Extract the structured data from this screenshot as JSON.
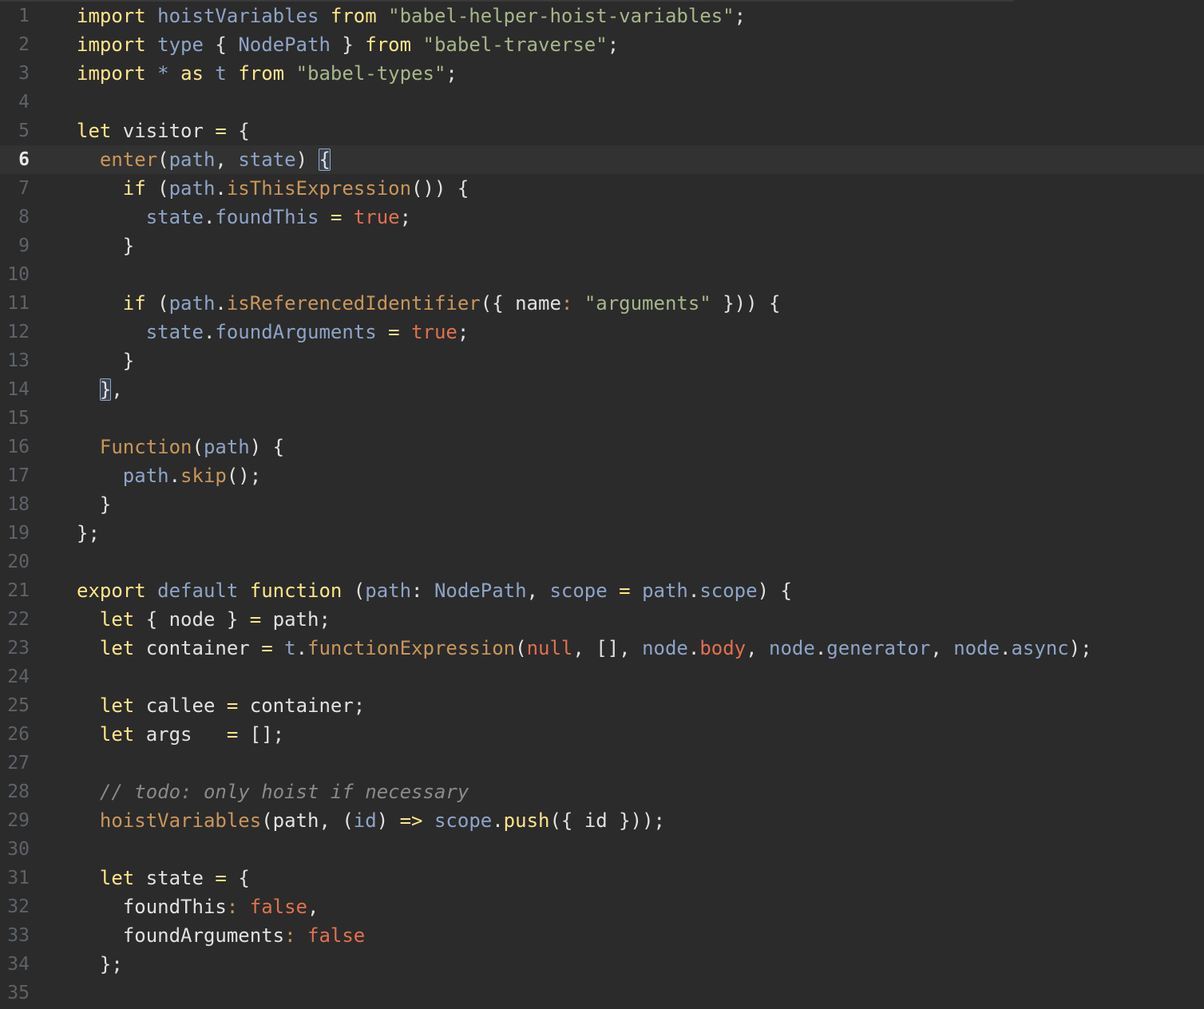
{
  "editor": {
    "current_line": 6,
    "lines": [
      {
        "num": "1",
        "tokens": [
          [
            "kw",
            "import "
          ],
          [
            "var",
            "hoistVariables "
          ],
          [
            "kw",
            "from "
          ],
          [
            "str",
            "\"babel-helper-hoist-variables\""
          ],
          [
            "plain",
            ";"
          ]
        ]
      },
      {
        "num": "2",
        "tokens": [
          [
            "kw",
            "import "
          ],
          [
            "var",
            "type "
          ],
          [
            "plain",
            "{ "
          ],
          [
            "var",
            "NodePath "
          ],
          [
            "plain",
            "} "
          ],
          [
            "kw",
            "from "
          ],
          [
            "str",
            "\"babel-traverse\""
          ],
          [
            "plain",
            ";"
          ]
        ]
      },
      {
        "num": "3",
        "tokens": [
          [
            "kw",
            "import "
          ],
          [
            "var",
            "* "
          ],
          [
            "kw",
            "as "
          ],
          [
            "var",
            "t "
          ],
          [
            "kw",
            "from "
          ],
          [
            "str",
            "\"babel-types\""
          ],
          [
            "plain",
            ";"
          ]
        ]
      },
      {
        "num": "4",
        "tokens": []
      },
      {
        "num": "5",
        "tokens": [
          [
            "kw",
            "let "
          ],
          [
            "plain",
            "visitor "
          ],
          [
            "kw",
            "= "
          ],
          [
            "plain",
            "{"
          ]
        ]
      },
      {
        "num": "6",
        "tokens": [
          [
            "plain",
            "  "
          ],
          [
            "fn",
            "enter"
          ],
          [
            "plain",
            "("
          ],
          [
            "var",
            "path"
          ],
          [
            "plain",
            ", "
          ],
          [
            "var",
            "state"
          ],
          [
            "plain",
            ") "
          ],
          [
            "bracket",
            "{"
          ]
        ]
      },
      {
        "num": "7",
        "tokens": [
          [
            "plain",
            "    "
          ],
          [
            "kw",
            "if "
          ],
          [
            "plain",
            "("
          ],
          [
            "var",
            "path"
          ],
          [
            "plain",
            "."
          ],
          [
            "fn",
            "isThisExpression"
          ],
          [
            "plain",
            "()) {"
          ]
        ]
      },
      {
        "num": "8",
        "tokens": [
          [
            "plain",
            "      "
          ],
          [
            "var",
            "state"
          ],
          [
            "plain",
            "."
          ],
          [
            "var",
            "foundThis "
          ],
          [
            "kw",
            "= "
          ],
          [
            "bool",
            "true"
          ],
          [
            "plain",
            ";"
          ]
        ]
      },
      {
        "num": "9",
        "tokens": [
          [
            "plain",
            "    }"
          ]
        ]
      },
      {
        "num": "10",
        "tokens": []
      },
      {
        "num": "11",
        "tokens": [
          [
            "plain",
            "    "
          ],
          [
            "kw",
            "if "
          ],
          [
            "plain",
            "("
          ],
          [
            "var",
            "path"
          ],
          [
            "plain",
            "."
          ],
          [
            "fn",
            "isReferencedIdentifier"
          ],
          [
            "plain",
            "({ name"
          ],
          [
            "fn",
            ": "
          ],
          [
            "str",
            "\"arguments\""
          ],
          [
            "plain",
            " })) {"
          ]
        ]
      },
      {
        "num": "12",
        "tokens": [
          [
            "plain",
            "      "
          ],
          [
            "var",
            "state"
          ],
          [
            "plain",
            "."
          ],
          [
            "var",
            "foundArguments "
          ],
          [
            "kw",
            "= "
          ],
          [
            "bool",
            "true"
          ],
          [
            "plain",
            ";"
          ]
        ]
      },
      {
        "num": "13",
        "tokens": [
          [
            "plain",
            "    }"
          ]
        ]
      },
      {
        "num": "14",
        "tokens": [
          [
            "plain",
            "  "
          ],
          [
            "bracket",
            "}"
          ],
          [
            "plain",
            ","
          ]
        ]
      },
      {
        "num": "15",
        "tokens": []
      },
      {
        "num": "16",
        "tokens": [
          [
            "plain",
            "  "
          ],
          [
            "fn",
            "Function"
          ],
          [
            "plain",
            "("
          ],
          [
            "var",
            "path"
          ],
          [
            "plain",
            ") {"
          ]
        ]
      },
      {
        "num": "17",
        "tokens": [
          [
            "plain",
            "    "
          ],
          [
            "var",
            "path"
          ],
          [
            "plain",
            "."
          ],
          [
            "fn",
            "skip"
          ],
          [
            "plain",
            "();"
          ]
        ]
      },
      {
        "num": "18",
        "tokens": [
          [
            "plain",
            "  }"
          ]
        ]
      },
      {
        "num": "19",
        "tokens": [
          [
            "plain",
            "};"
          ]
        ]
      },
      {
        "num": "20",
        "tokens": []
      },
      {
        "num": "21",
        "tokens": [
          [
            "kw",
            "export "
          ],
          [
            "var",
            "default "
          ],
          [
            "kw",
            "function "
          ],
          [
            "plain",
            "("
          ],
          [
            "var",
            "path"
          ],
          [
            "plain",
            ": "
          ],
          [
            "var",
            "NodePath"
          ],
          [
            "plain",
            ", "
          ],
          [
            "var",
            "scope "
          ],
          [
            "kw",
            "= "
          ],
          [
            "var",
            "path"
          ],
          [
            "plain",
            "."
          ],
          [
            "var",
            "scope"
          ],
          [
            "plain",
            ") {"
          ]
        ]
      },
      {
        "num": "22",
        "tokens": [
          [
            "plain",
            "  "
          ],
          [
            "kw",
            "let "
          ],
          [
            "plain",
            "{ node } "
          ],
          [
            "kw",
            "= "
          ],
          [
            "plain",
            "path;"
          ]
        ]
      },
      {
        "num": "23",
        "tokens": [
          [
            "plain",
            "  "
          ],
          [
            "kw",
            "let "
          ],
          [
            "plain",
            "container "
          ],
          [
            "kw",
            "= "
          ],
          [
            "var",
            "t"
          ],
          [
            "plain",
            "."
          ],
          [
            "fn",
            "functionExpression"
          ],
          [
            "plain",
            "("
          ],
          [
            "bool",
            "null"
          ],
          [
            "plain",
            ", [], "
          ],
          [
            "var",
            "node"
          ],
          [
            "plain",
            "."
          ],
          [
            "bool",
            "body"
          ],
          [
            "plain",
            ", "
          ],
          [
            "var",
            "node"
          ],
          [
            "plain",
            "."
          ],
          [
            "var",
            "generator"
          ],
          [
            "plain",
            ", "
          ],
          [
            "var",
            "node"
          ],
          [
            "plain",
            "."
          ],
          [
            "var",
            "async"
          ],
          [
            "plain",
            ");"
          ]
        ]
      },
      {
        "num": "24",
        "tokens": []
      },
      {
        "num": "25",
        "tokens": [
          [
            "plain",
            "  "
          ],
          [
            "kw",
            "let "
          ],
          [
            "plain",
            "callee "
          ],
          [
            "kw",
            "= "
          ],
          [
            "plain",
            "container;"
          ]
        ]
      },
      {
        "num": "26",
        "tokens": [
          [
            "plain",
            "  "
          ],
          [
            "kw",
            "let "
          ],
          [
            "plain",
            "args   "
          ],
          [
            "kw",
            "= "
          ],
          [
            "plain",
            "[];"
          ]
        ]
      },
      {
        "num": "27",
        "tokens": []
      },
      {
        "num": "28",
        "tokens": [
          [
            "plain",
            "  "
          ],
          [
            "comment",
            "// todo: only hoist if necessary"
          ]
        ]
      },
      {
        "num": "29",
        "tokens": [
          [
            "plain",
            "  "
          ],
          [
            "fn",
            "hoistVariables"
          ],
          [
            "plain",
            "(path, ("
          ],
          [
            "var",
            "id"
          ],
          [
            "plain",
            ") "
          ],
          [
            "kw",
            "=> "
          ],
          [
            "var",
            "scope"
          ],
          [
            "plain",
            "."
          ],
          [
            "kw",
            "push"
          ],
          [
            "plain",
            "({ id }));"
          ]
        ]
      },
      {
        "num": "30",
        "tokens": []
      },
      {
        "num": "31",
        "tokens": [
          [
            "plain",
            "  "
          ],
          [
            "kw",
            "let "
          ],
          [
            "plain",
            "state "
          ],
          [
            "kw",
            "= "
          ],
          [
            "plain",
            "{"
          ]
        ]
      },
      {
        "num": "32",
        "tokens": [
          [
            "plain",
            "    foundThis"
          ],
          [
            "fn",
            ": "
          ],
          [
            "bool",
            "false"
          ],
          [
            "plain",
            ","
          ]
        ]
      },
      {
        "num": "33",
        "tokens": [
          [
            "plain",
            "    foundArguments"
          ],
          [
            "fn",
            ": "
          ],
          [
            "bool",
            "false"
          ]
        ]
      },
      {
        "num": "34",
        "tokens": [
          [
            "plain",
            "  };"
          ]
        ]
      },
      {
        "num": "35",
        "tokens": []
      }
    ]
  }
}
